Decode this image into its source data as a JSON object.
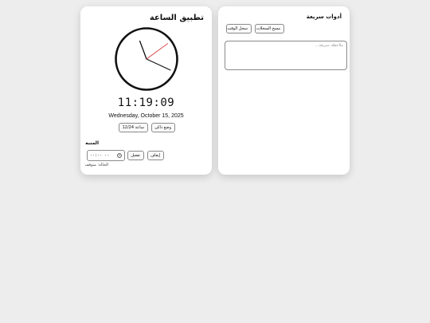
{
  "clock_card": {
    "title": "تطبيق الساعة",
    "digital_time": "11:19:09",
    "date": "Wednesday, October 15, 2025",
    "dark_mode_button": "وضع داكن",
    "format_button": "ساعة 12/24",
    "analog": {
      "hour": 11,
      "minute": 19,
      "second": 9
    },
    "alarm": {
      "section_title": "المنبه",
      "input_value": "--:-- --",
      "input_icon": "clock-icon",
      "activate_button": "تفعيل",
      "stop_button": "إيقاف",
      "status": "الحالة: متوقف"
    }
  },
  "tools_card": {
    "title": "أدوات سريعة",
    "clear_log_button": "مسح السجلات",
    "log_time_button": "سجل الوقت",
    "note_placeholder": "ملاحظة سريعة..."
  },
  "colors": {
    "background": "#ededed",
    "card": "#ffffff",
    "second_hand": "#d32f2f",
    "hands": "#111111"
  }
}
